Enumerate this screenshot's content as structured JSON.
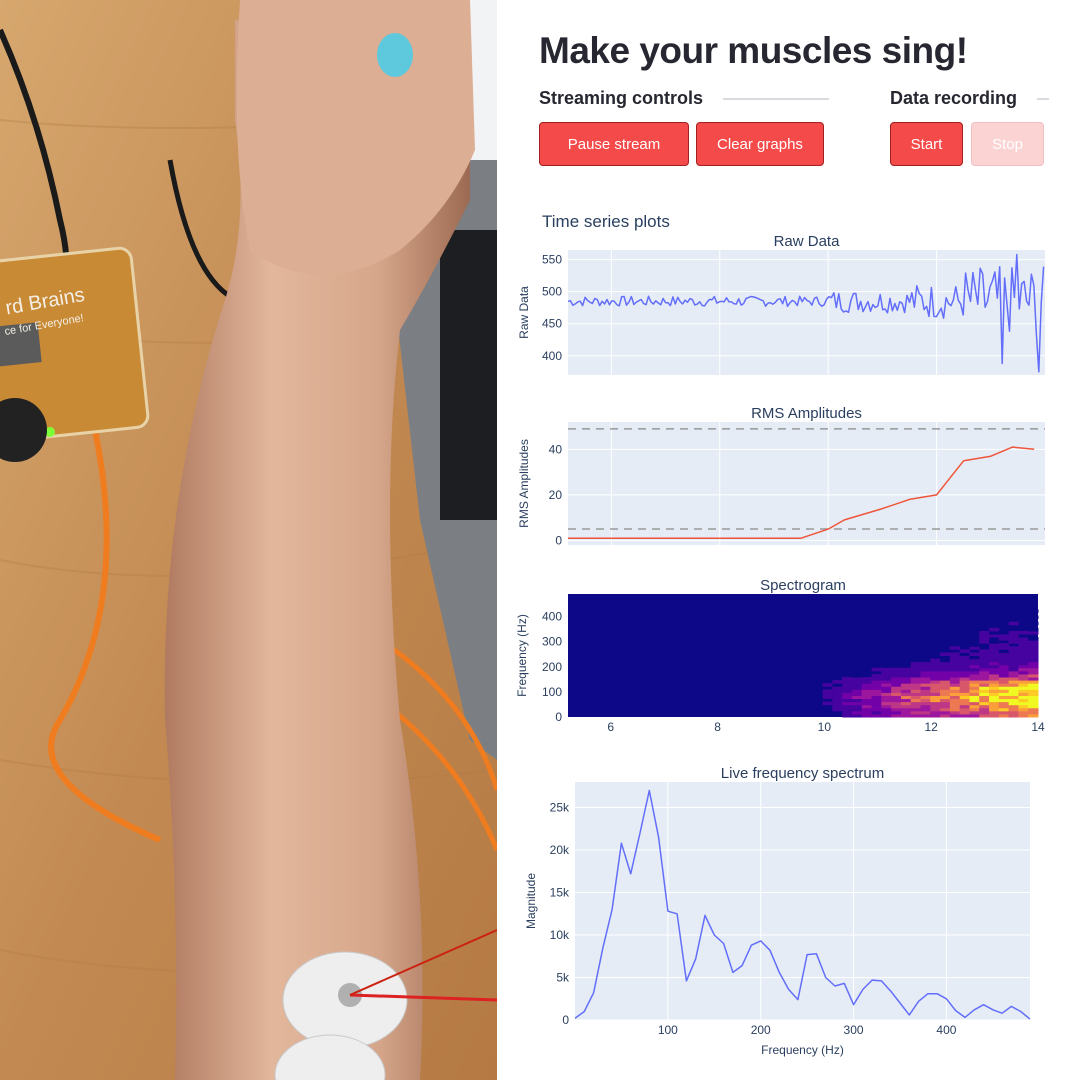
{
  "app": {
    "title": "Make your muscles sing!",
    "streaming": {
      "heading": "Streaming controls",
      "pause_label": "Pause stream",
      "clear_label": "Clear graphs"
    },
    "recording": {
      "heading": "Data recording",
      "start_label": "Start",
      "stop_label": "Stop"
    },
    "plots_heading": "Time series plots",
    "accent_color": "#f54a4a"
  },
  "photo": {
    "board_text_1": "rd Brains",
    "board_text_2": "ce for Everyone!"
  },
  "chart_data": [
    {
      "type": "line",
      "title": "Raw Data",
      "ylabel": "Raw Data",
      "xlim": [
        5.2,
        14
      ],
      "ylim": [
        370,
        565
      ],
      "yticks": [
        400,
        450,
        500,
        550
      ],
      "x_grid": [
        6,
        8,
        10,
        12
      ],
      "color": "#636efa",
      "seed": 7
    },
    {
      "type": "line",
      "title": "RMS Amplitudes",
      "ylabel": "RMS Amplitudes",
      "xlim": [
        5.2,
        14
      ],
      "ylim": [
        -2,
        52
      ],
      "yticks": [
        0,
        20,
        40
      ],
      "x_grid": [
        6,
        8,
        10,
        12
      ],
      "color": "#ef553b",
      "thresholds": [
        5,
        49
      ],
      "x": [
        5.2,
        6,
        7,
        8,
        9,
        9.5,
        10,
        10.3,
        11,
        11.5,
        12,
        12.2,
        12.5,
        13,
        13.4,
        13.8
      ],
      "y": [
        1,
        1,
        1,
        1,
        1,
        1,
        5,
        9,
        14,
        18,
        20,
        26,
        35,
        37,
        41,
        40
      ]
    },
    {
      "type": "heatmap",
      "title": "Spectrogram",
      "ylabel": "Frequency (Hz)",
      "xlim": [
        5.2,
        14
      ],
      "ylim": [
        0,
        490
      ],
      "yticks": [
        0,
        100,
        200,
        300,
        400
      ],
      "xticks": [
        6,
        8,
        10,
        12,
        14
      ],
      "colorscale": [
        "#0d0887",
        "#46039f",
        "#7201a8",
        "#9c179e",
        "#bd3786",
        "#d8576b",
        "#ed7953",
        "#fb9f3a",
        "#fdca26",
        "#f0f921"
      ]
    },
    {
      "type": "line",
      "title": "Live frequency spectrum",
      "xlabel": "Frequency (Hz)",
      "ylabel": "Magnitude",
      "xlim": [
        0,
        490
      ],
      "ylim": [
        0,
        28000
      ],
      "xticks": [
        100,
        200,
        300,
        400
      ],
      "yticks": [
        0,
        5000,
        10000,
        15000,
        20000,
        25000
      ],
      "ytick_labels": [
        "0",
        "5k",
        "10k",
        "15k",
        "20k",
        "25k"
      ],
      "color": "#636efa",
      "x": [
        0,
        10,
        20,
        30,
        40,
        50,
        60,
        70,
        80,
        90,
        100,
        110,
        120,
        130,
        140,
        150,
        160,
        170,
        180,
        190,
        200,
        210,
        220,
        230,
        240,
        250,
        260,
        270,
        280,
        290,
        300,
        310,
        320,
        330,
        340,
        350,
        360,
        370,
        380,
        390,
        400,
        410,
        420,
        430,
        440,
        450,
        460,
        470,
        480,
        490
      ],
      "y": [
        200,
        1000,
        3200,
        8500,
        13000,
        20800,
        17200,
        22000,
        27000,
        21500,
        12800,
        12500,
        4600,
        7200,
        12300,
        10000,
        9000,
        5600,
        6400,
        8800,
        9300,
        8200,
        5600,
        3600,
        2400,
        7700,
        7800,
        5000,
        4000,
        4300,
        1800,
        3600,
        4700,
        4600,
        3400,
        2000,
        600,
        2200,
        3100,
        3100,
        2500,
        1100,
        300,
        1200,
        1800,
        1200,
        800,
        1600,
        1000,
        100
      ]
    }
  ]
}
